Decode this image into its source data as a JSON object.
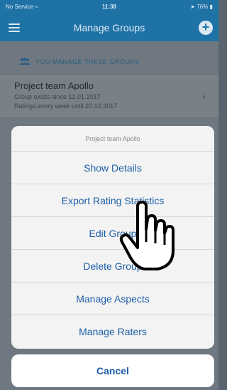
{
  "status_bar": {
    "carrier": "No Service",
    "time": "11:38",
    "battery": "76%"
  },
  "nav": {
    "title": "Manage Groups"
  },
  "section": {
    "label": "YOU MANAGE THESE GROUPS"
  },
  "group": {
    "name": "Project team Apollo",
    "line1": "Group exists since 12.01.2017",
    "line2": "Ratings every week until 20.12.2017"
  },
  "action_sheet": {
    "title": "Project team Apollo",
    "actions": [
      "Show Details",
      "Export Rating Statistics",
      "Edit Group",
      "Delete Group",
      "Manage Aspects",
      "Manage Raters"
    ],
    "cancel": "Cancel"
  },
  "colors": {
    "brand_blue": "#1f72a6",
    "action_text": "#1d5fa8"
  }
}
